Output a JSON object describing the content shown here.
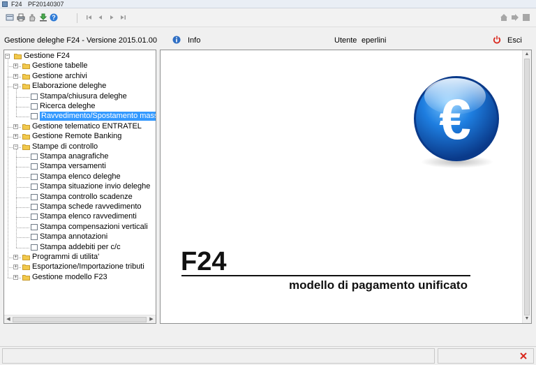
{
  "window": {
    "title": "F24",
    "subtitle": "PF20140307"
  },
  "infobar": {
    "app_version": "Gestione deleghe F24 - Versione 2015.01.00",
    "info_label": "Info",
    "user_label": "Utente",
    "user_value": "eperlini",
    "exit_label": "Esci"
  },
  "tree": {
    "root": "Gestione F24",
    "items": [
      {
        "label": "Gestione tabelle"
      },
      {
        "label": "Gestione archivi"
      },
      {
        "label": "Elaborazione deleghe"
      },
      {
        "label": "Stampa/chiusura deleghe"
      },
      {
        "label": "Ricerca deleghe"
      },
      {
        "label": "Ravvedimento/Spostamento massivo"
      },
      {
        "label": "Gestione telematico ENTRATEL"
      },
      {
        "label": "Gestione Remote Banking"
      },
      {
        "label": "Stampe di controllo"
      },
      {
        "label": "Stampa anagrafiche"
      },
      {
        "label": "Stampa versamenti"
      },
      {
        "label": "Stampa elenco deleghe"
      },
      {
        "label": "Stampa situazione invio deleghe"
      },
      {
        "label": "Stampa controllo scadenze"
      },
      {
        "label": "Stampa schede ravvedimento"
      },
      {
        "label": "Stampa elenco ravvedimenti"
      },
      {
        "label": "Stampa compensazioni verticali"
      },
      {
        "label": "Stampa annotazioni"
      },
      {
        "label": "Stampa addebiti per c/c"
      },
      {
        "label": "Programmi di utilita'"
      },
      {
        "label": "Esportazione/Importazione tributi"
      },
      {
        "label": "Gestione modello F23"
      }
    ]
  },
  "main": {
    "logo_title": "F24",
    "logo_subtitle": "modello di pagamento unificato",
    "euro_symbol": "€"
  },
  "colors": {
    "selection": "#3399ff",
    "exit_icon": "#d9261c",
    "euro_blue": "#1565c0"
  }
}
